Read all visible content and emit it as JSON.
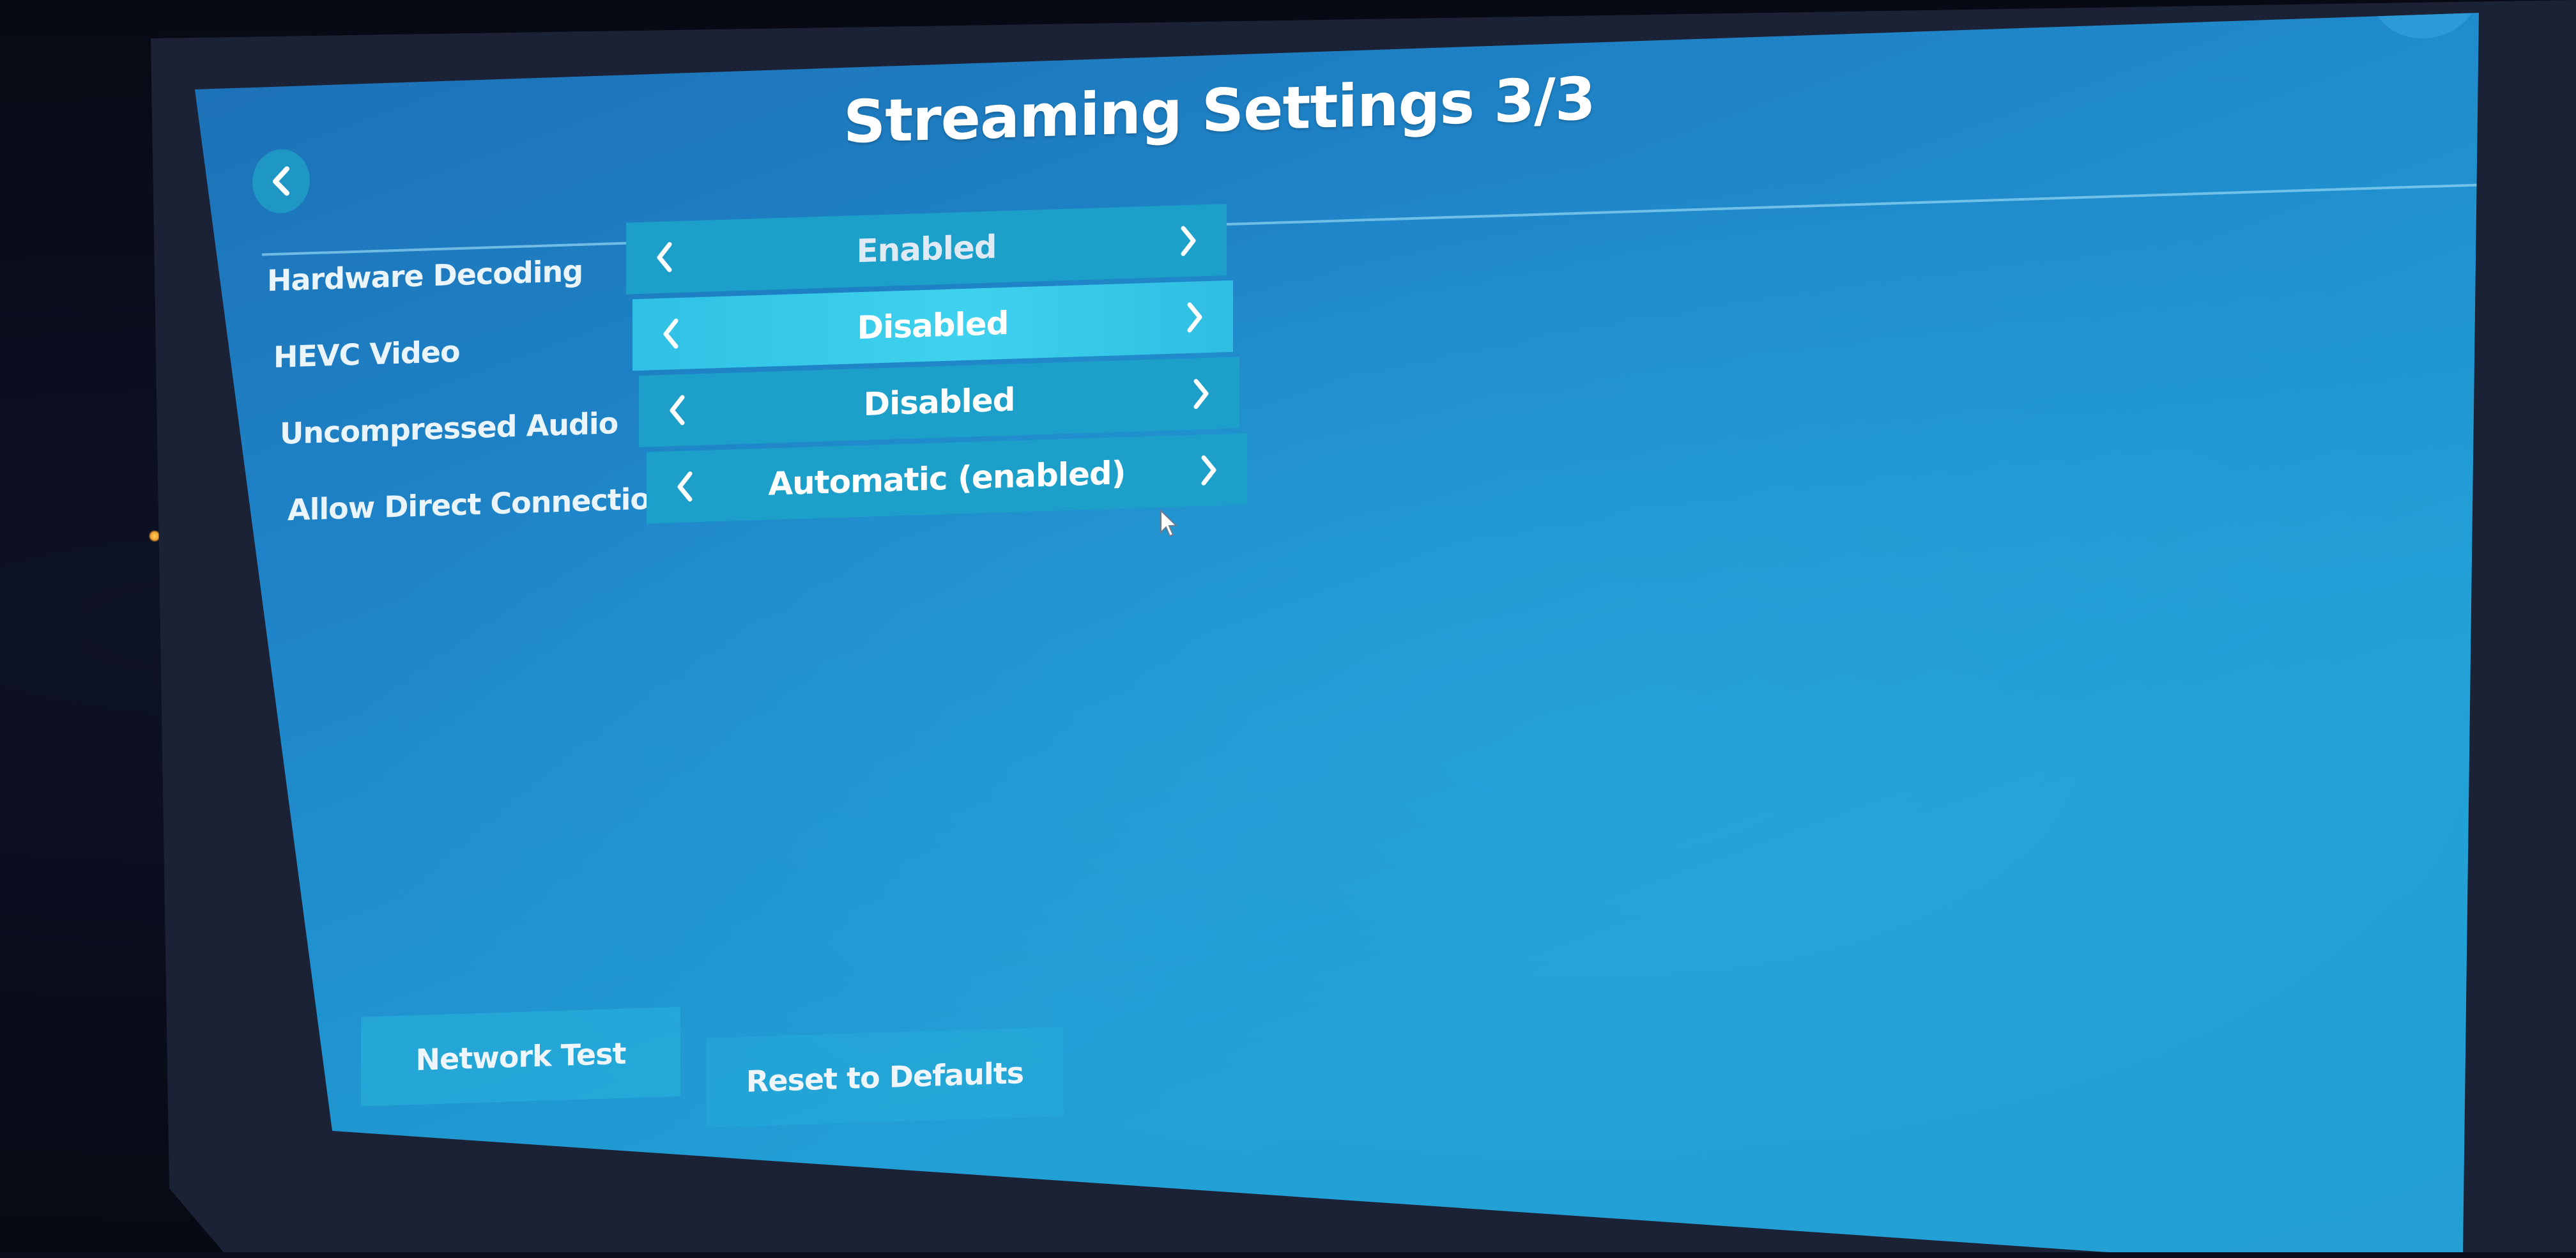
{
  "header": {
    "title": "Streaming Settings 3/3",
    "back_icon": "chevron-left-icon",
    "help_label": "?"
  },
  "settings": [
    {
      "label": "Hardware Decoding",
      "value": "Enabled",
      "selected": false
    },
    {
      "label": "HEVC Video",
      "value": "Disabled",
      "selected": true
    },
    {
      "label": "Uncompressed Audio",
      "value": "Disabled",
      "selected": false
    },
    {
      "label": "Allow Direct Connection",
      "value": "Automatic (enabled)",
      "selected": false
    }
  ],
  "footer": {
    "network_test_label": "Network Test",
    "reset_label": "Reset to Defaults"
  },
  "colors": {
    "background": "#1f86c9",
    "selector": "#1c9fc9",
    "selector_selected": "#3fd2ee",
    "text": "#ffffff"
  }
}
